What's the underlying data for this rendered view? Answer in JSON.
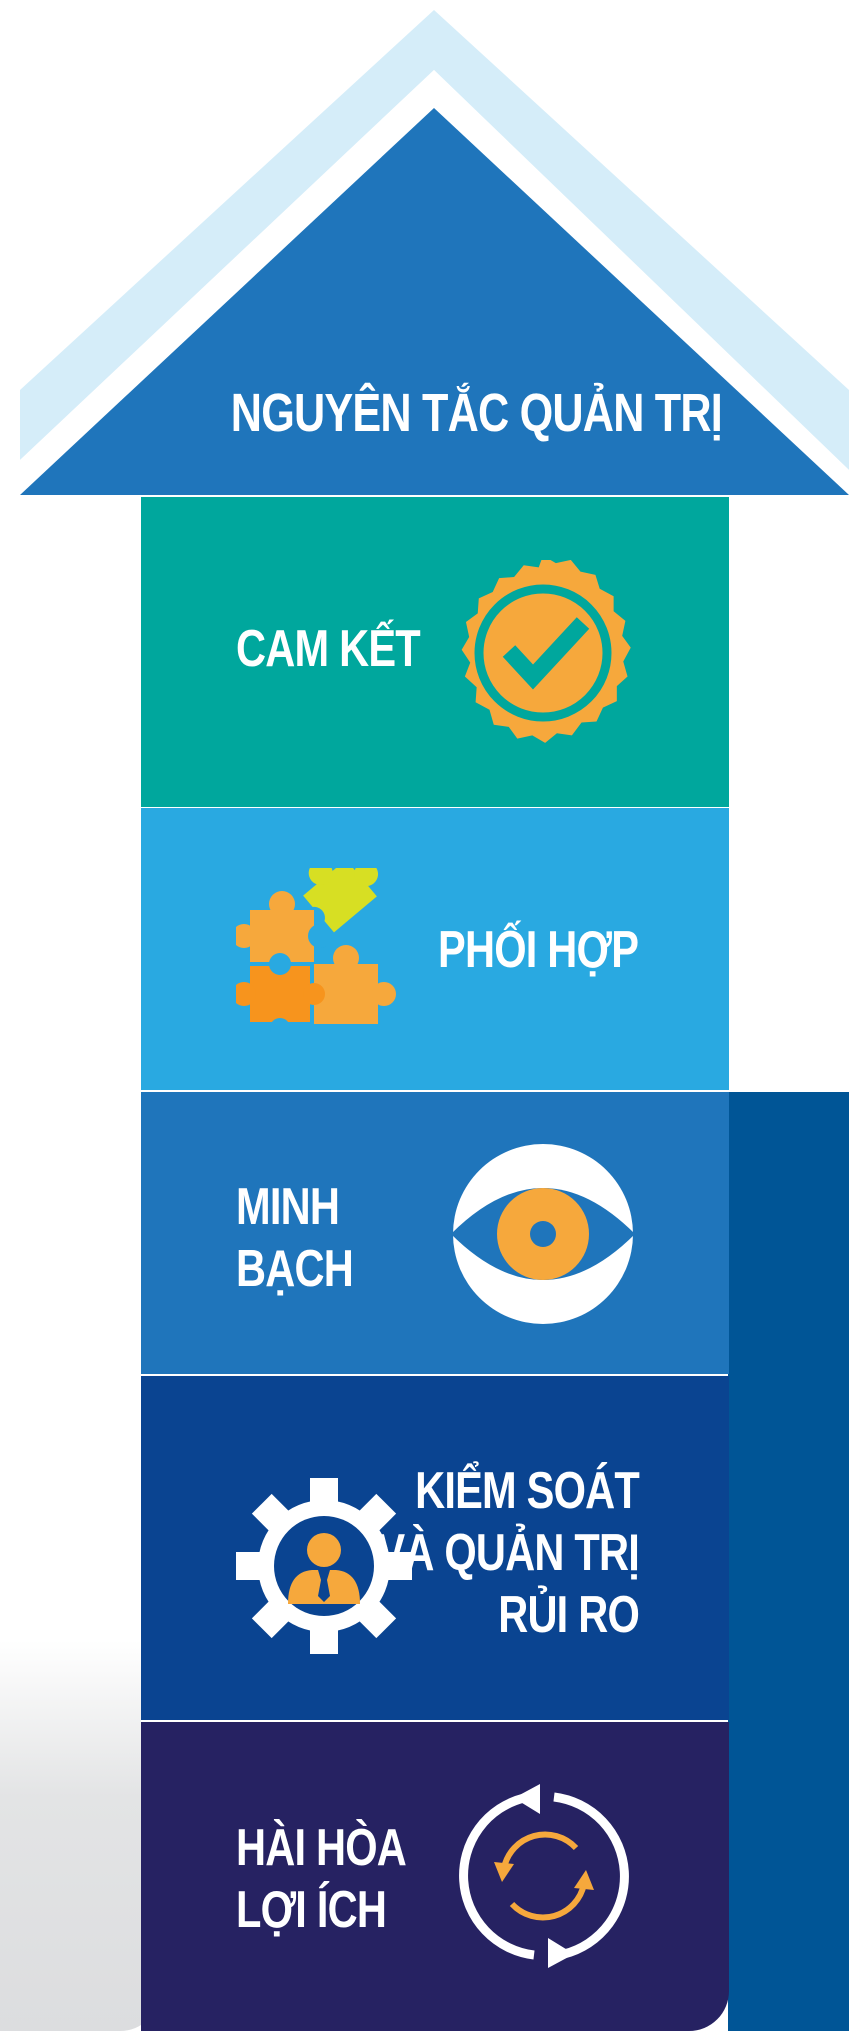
{
  "roof": {
    "title": "NGUYÊN TẮC QUẢN TRỊ"
  },
  "blocks": [
    {
      "id": "cam-ket",
      "lines": [
        "CAM KẾT"
      ],
      "icon": "badge-check-icon",
      "bg": "#00A79D"
    },
    {
      "id": "phoi-hop",
      "lines": [
        "PHỐI HỢP"
      ],
      "icon": "puzzle-icon",
      "bg": "#29A9E1"
    },
    {
      "id": "minh-bach",
      "lines": [
        "MINH",
        "BẠCH"
      ],
      "icon": "eye-icon",
      "bg": "#1F75BB"
    },
    {
      "id": "kiem-soat",
      "lines": [
        "KIỂM SOÁT",
        "VÀ QUẢN TRỊ",
        "RỦI RO"
      ],
      "icon": "gear-person-icon",
      "bg": "#0A4491"
    },
    {
      "id": "hai-hoa",
      "lines": [
        "HÀI HÒA",
        "LỢI ÍCH"
      ],
      "icon": "cycle-arrows-icon",
      "bg": "#262262"
    }
  ],
  "colors": {
    "roof_outer": "#D5EDF9",
    "roof_inner": "#1F75BB",
    "right_band": "#005596",
    "icon_orange": "#F6A83C",
    "puzzle_lime": "#D7DF23",
    "puzzle_dark_orange": "#F7941D",
    "left_fade": "#E3E4E5"
  }
}
